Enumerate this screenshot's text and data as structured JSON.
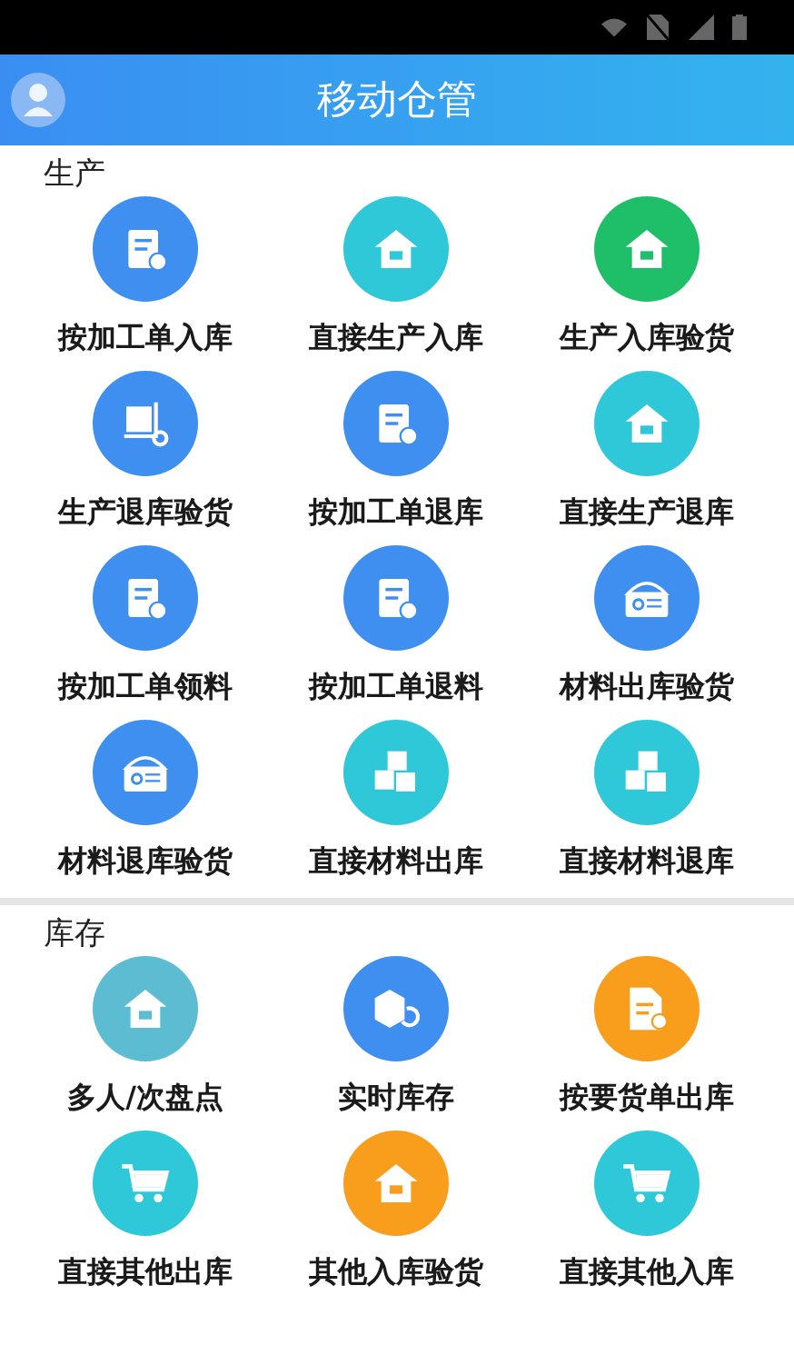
{
  "header": {
    "title": "移动仓管"
  },
  "sections": [
    {
      "title": "生产",
      "items": [
        {
          "label": "按加工单入库",
          "kind": "clipboard",
          "color": "#3f8ff0"
        },
        {
          "label": "直接生产入库",
          "kind": "house",
          "color": "#2fc8d8"
        },
        {
          "label": "生产入库验货",
          "kind": "house",
          "color": "#1fbf69"
        },
        {
          "label": "生产退库验货",
          "kind": "dolly",
          "color": "#3f8ff0"
        },
        {
          "label": "按加工单退库",
          "kind": "clipboard",
          "color": "#3f8ff0"
        },
        {
          "label": "直接生产退库",
          "kind": "house",
          "color": "#2fc8d8"
        },
        {
          "label": "按加工单领料",
          "kind": "clipboard",
          "color": "#3f8ff0"
        },
        {
          "label": "按加工单退料",
          "kind": "clipboard",
          "color": "#3f8ff0"
        },
        {
          "label": "材料出库验货",
          "kind": "tray",
          "color": "#3f8ff0"
        },
        {
          "label": "材料退库验货",
          "kind": "tray",
          "color": "#3f8ff0"
        },
        {
          "label": "直接材料出库",
          "kind": "cubes",
          "color": "#2fc8d8"
        },
        {
          "label": "直接材料退库",
          "kind": "cubes",
          "color": "#2fc8d8"
        }
      ]
    },
    {
      "title": "库存",
      "items": [
        {
          "label": "多人/次盘点",
          "kind": "house",
          "color": "#5bbcd2"
        },
        {
          "label": "实时库存",
          "kind": "cube",
          "color": "#3f8ff0"
        },
        {
          "label": "按要货单出库",
          "kind": "document",
          "color": "#f99d1c"
        },
        {
          "label": "直接其他出库",
          "kind": "cart",
          "color": "#2fc8d8"
        },
        {
          "label": "其他入库验货",
          "kind": "house",
          "color": "#f99d1c"
        },
        {
          "label": "直接其他入库",
          "kind": "cart",
          "color": "#2fc8d8"
        }
      ]
    }
  ]
}
